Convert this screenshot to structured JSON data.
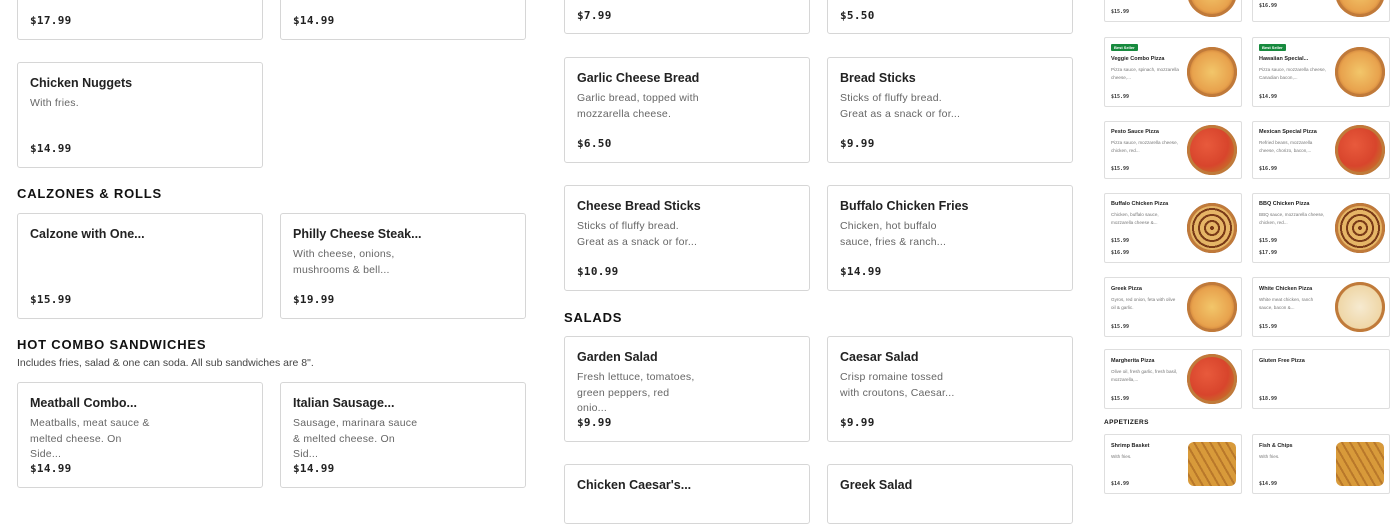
{
  "left": {
    "top_row": [
      {
        "price": "$17.99"
      },
      {
        "price": "$14.99"
      }
    ],
    "nuggets": {
      "name": "Chicken Nuggets",
      "desc": "With fries.",
      "price": "$14.99"
    },
    "calzones_title": "CALZONES & ROLLS",
    "calzones": [
      {
        "name": "Calzone with One...",
        "desc": "",
        "price": "$15.99"
      },
      {
        "name": "Philly Cheese Steak...",
        "desc": "With cheese, onions, mushrooms & bell...",
        "price": "$19.99"
      }
    ],
    "hot_title": "HOT COMBO SANDWICHES",
    "hot_sub": "Includes fries, salad & one can soda. All sub sandwiches are 8\".",
    "hot": [
      {
        "name": "Meatball Combo...",
        "desc": "Meatballs, meat sauce & melted cheese. On Side...",
        "price": "$14.99"
      },
      {
        "name": "Italian Sausage...",
        "desc": "Sausage, marinara sauce & melted cheese. On Sid...",
        "price": "$14.99"
      }
    ]
  },
  "middle": {
    "top_row": [
      {
        "price": "$7.99"
      },
      {
        "price": "$5.50"
      }
    ],
    "row1": [
      {
        "name": "Garlic Cheese Bread",
        "desc": "Garlic bread, topped with mozzarella cheese.",
        "price": "$6.50"
      },
      {
        "name": "Bread Sticks",
        "desc": "Sticks of fluffy bread. Great as a snack or for...",
        "price": "$9.99"
      }
    ],
    "row2": [
      {
        "name": "Cheese Bread Sticks",
        "desc": "Sticks of fluffy bread. Great as a snack or for...",
        "price": "$10.99"
      },
      {
        "name": "Buffalo Chicken Fries",
        "desc": "Chicken, hot buffalo sauce, fries & ranch...",
        "price": "$14.99"
      }
    ],
    "salads_title": "SALADS",
    "salads": [
      {
        "name": "Garden Salad",
        "desc": "Fresh lettuce, tomatoes, green peppers, red onio...",
        "price": "$9.99"
      },
      {
        "name": "Caesar Salad",
        "desc": "Crisp romaine tossed with croutons, Caesar...",
        "price": "$9.99"
      }
    ],
    "bottom": [
      {
        "name": "Chicken Caesar's..."
      },
      {
        "name": "Greek Salad"
      }
    ]
  },
  "right": {
    "top": [
      {
        "price": "$15.99"
      },
      {
        "price": "$16.99"
      }
    ],
    "pizzas": [
      {
        "badge": "Best Seller",
        "name": "Veggie Combo Pizza",
        "desc": "Pizza sauce, spinach, mozzarella cheese,...",
        "price": "$15.99"
      },
      {
        "badge": "Best Seller",
        "name": "Hawaiian Special...",
        "desc": "Pizza sauce, mozzarella cheese, Canadian bacon,...",
        "price": "$14.99"
      },
      {
        "name": "Pesto Sauce Pizza",
        "desc": "Pizza sauce, mozzarella cheese, chicken, red...",
        "price": "$15.99"
      },
      {
        "name": "Mexican Special Pizza",
        "desc": "Refried beans, mozzarella cheese, chorizo, bacon,...",
        "price": "$16.99"
      },
      {
        "name": "Buffalo Chicken Pizza",
        "desc": "Chicken, buffalo sauce, mozzarella cheese &...",
        "price": "$15.99",
        "price2": "$16.99"
      },
      {
        "name": "BBQ Chicken Pizza",
        "desc": "BBQ sauce, mozzarella cheese, chicken, red...",
        "price": "$15.99",
        "price2": "$17.99"
      },
      {
        "name": "Greek Pizza",
        "desc": "Gyros, red onion, feta with olive oil & garlic.",
        "price": "$15.99"
      },
      {
        "name": "White Chicken Pizza",
        "desc": "White meat chicken, ranch sauce, bacon &...",
        "price": "$15.99"
      },
      {
        "name": "Margherita Pizza",
        "desc": "Olive oil, fresh garlic, fresh basil, mozzarella,...",
        "price": "$15.99"
      },
      {
        "name": "Gluten Free Pizza",
        "desc": "",
        "price": "$18.99"
      }
    ],
    "appetizers_title": "APPETIZERS",
    "appetizers": [
      {
        "name": "Shrimp Basket",
        "desc": "With fries.",
        "price": "$14.99"
      },
      {
        "name": "Fish & Chips",
        "desc": "With fries.",
        "price": "$14.99"
      }
    ]
  },
  "colors": {
    "badge": "#178a3e",
    "border": "#d6d6d6"
  }
}
